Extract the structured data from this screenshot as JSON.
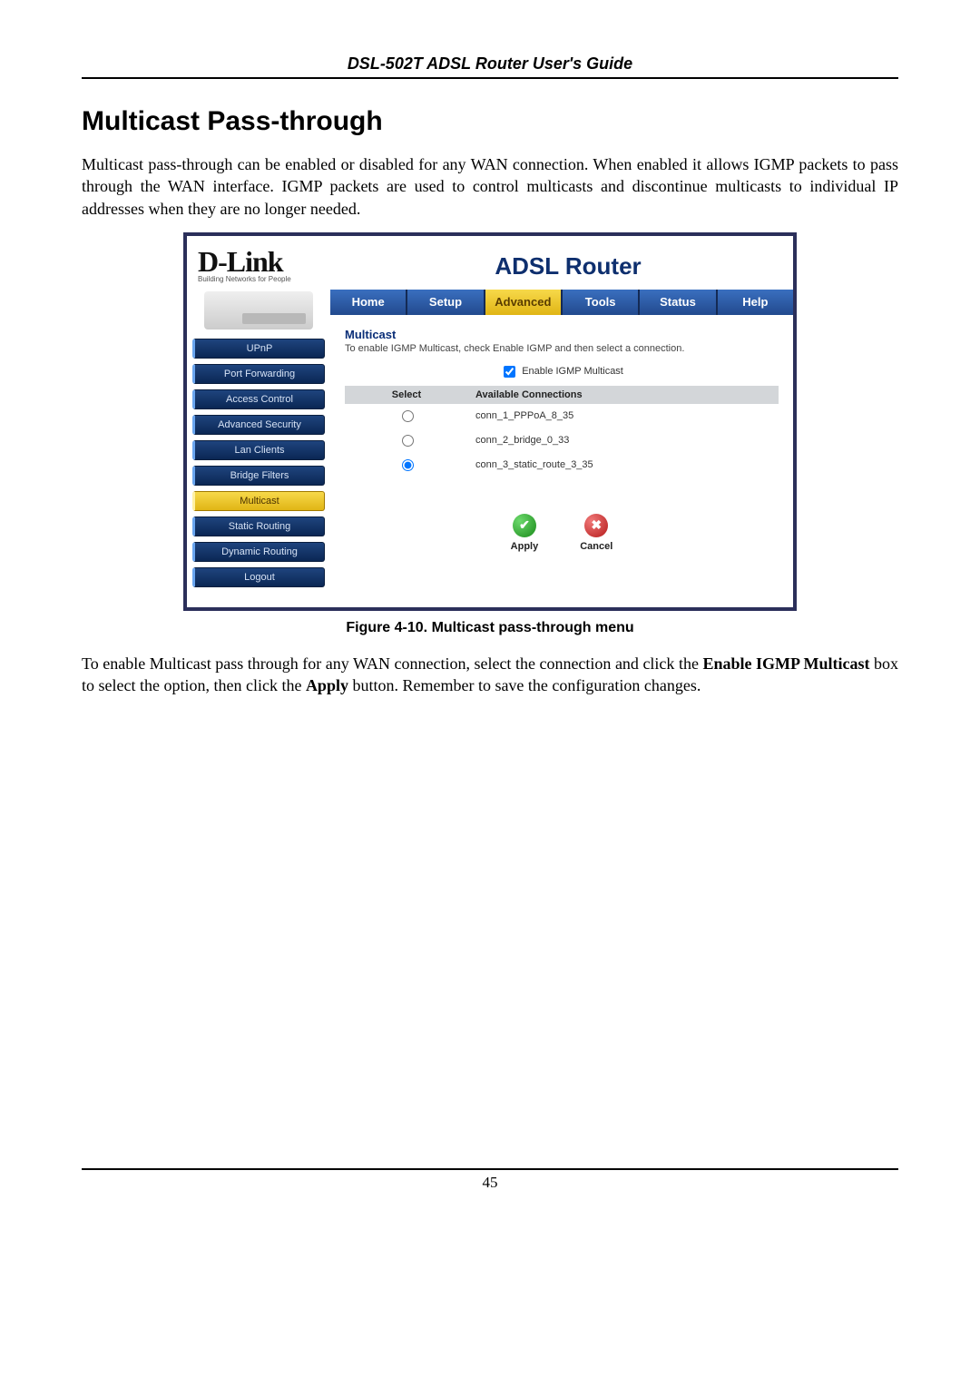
{
  "header": {
    "title": "DSL-502T ADSL Router User's Guide"
  },
  "section": {
    "title": "Multicast Pass-through",
    "paragraph1": "Multicast pass-through can be enabled or disabled for any WAN connection. When enabled it allows IGMP packets to pass through the WAN interface. IGMP packets are used to control multicasts and discontinue multicasts to individual IP addresses when they are no longer needed."
  },
  "router": {
    "logo": "D-Link",
    "logo_sub": "Building Networks for People",
    "title": "ADSL Router",
    "tabs": [
      "Home",
      "Setup",
      "Advanced",
      "Tools",
      "Status",
      "Help"
    ],
    "active_tab_index": 2,
    "sidebar": [
      "UPnP",
      "Port Forwarding",
      "Access Control",
      "Advanced Security",
      "Lan Clients",
      "Bridge Filters",
      "Multicast",
      "Static Routing",
      "Dynamic Routing",
      "Logout"
    ],
    "active_sidebar_index": 6,
    "panel": {
      "heading": "Multicast",
      "subtext": "To enable IGMP Multicast, check Enable IGMP and then select a connection.",
      "enable_label": "Enable IGMP Multicast",
      "enable_checked": true,
      "columns": {
        "select": "Select",
        "avail": "Available Connections"
      },
      "rows": [
        {
          "name": "conn_1_PPPoA_8_35",
          "selected": false
        },
        {
          "name": "conn_2_bridge_0_33",
          "selected": false
        },
        {
          "name": "conn_3_static_route_3_35",
          "selected": true
        }
      ],
      "apply_label": "Apply",
      "cancel_label": "Cancel"
    }
  },
  "figure_caption": "Figure 4-10. Multicast pass-through menu",
  "body_after": {
    "pre": "To enable Multicast pass through for any WAN connection, select the connection and click the ",
    "bold1": "Enable IGMP Multicast",
    "mid": " box to select the option, then click the ",
    "bold2": "Apply",
    "post": " button. Remember to save the configuration changes."
  },
  "footer": {
    "page": "45"
  }
}
